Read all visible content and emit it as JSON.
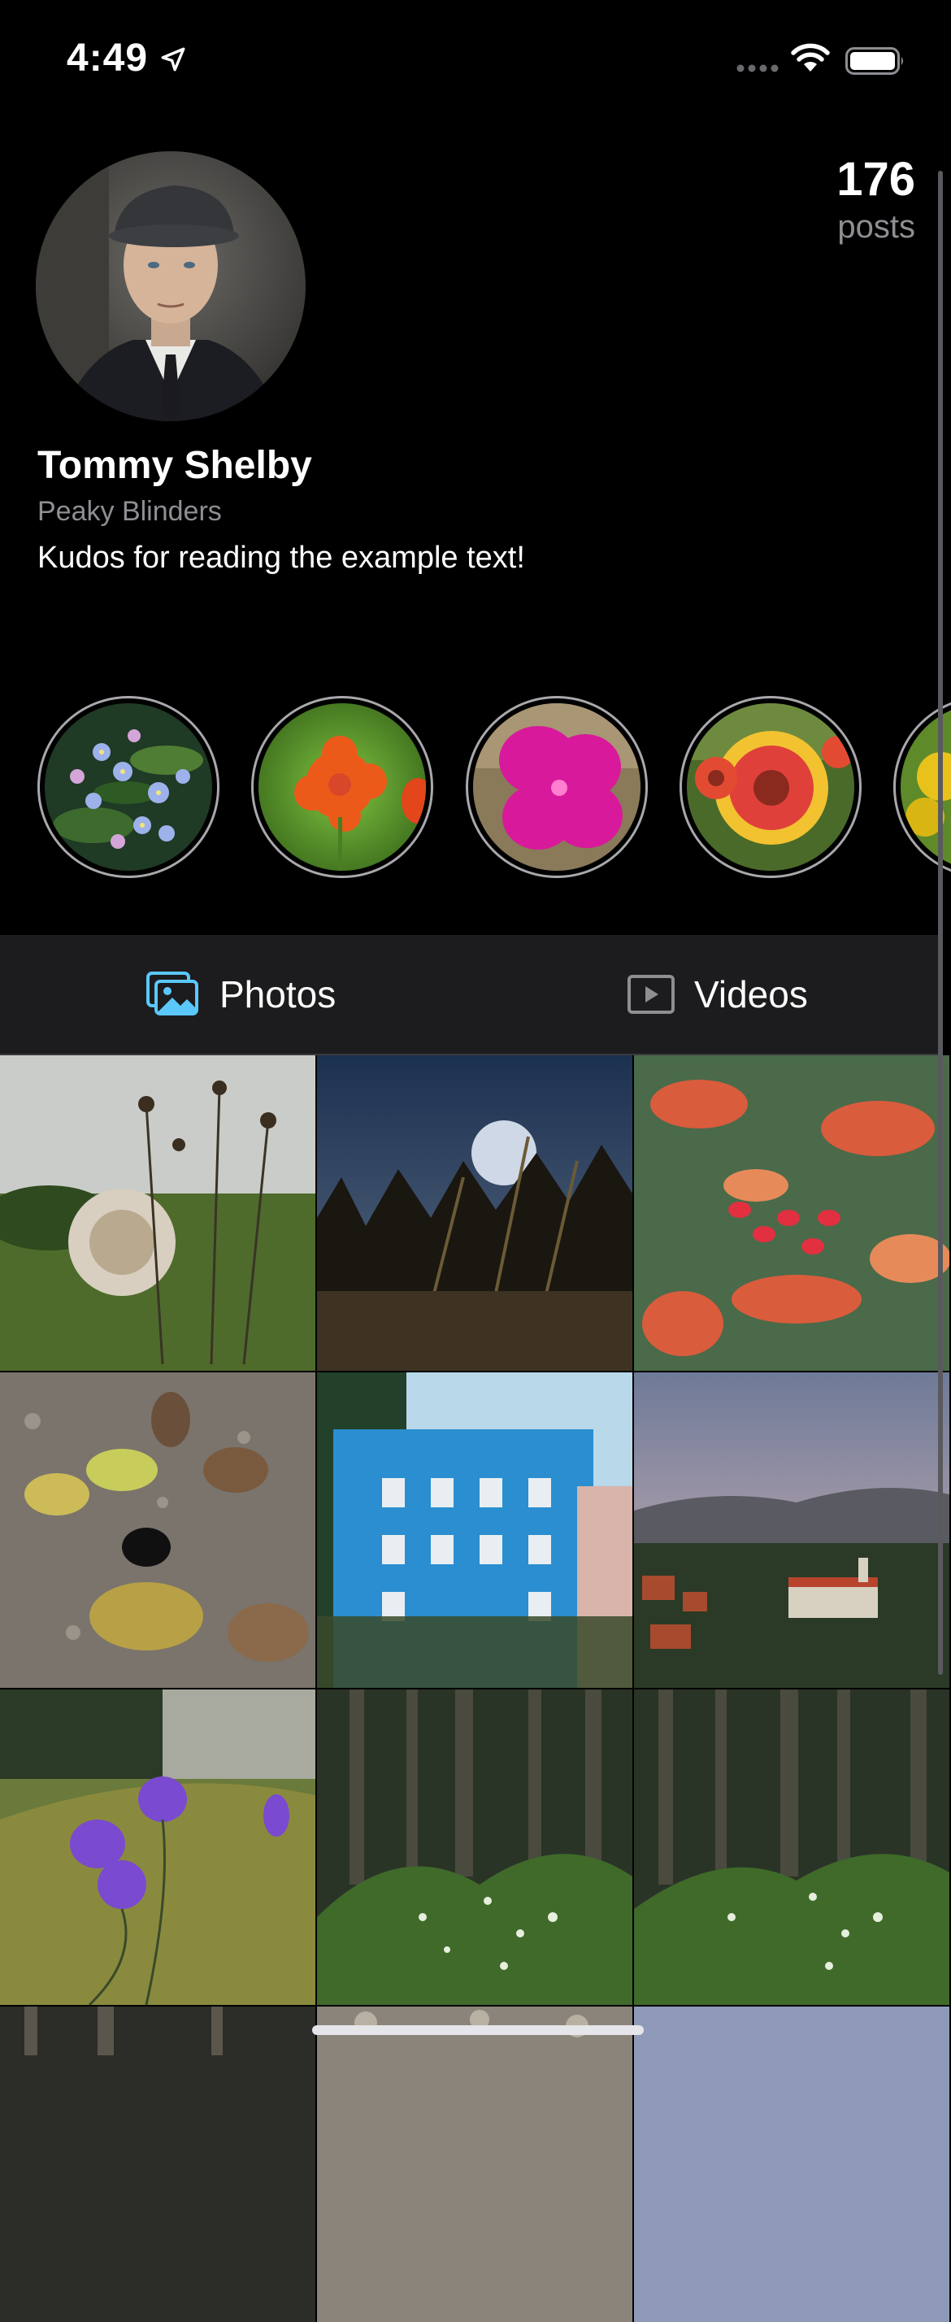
{
  "status_bar": {
    "time": "4:49"
  },
  "profile": {
    "name": "Tommy Shelby",
    "subtitle": "Peaky Blinders",
    "bio": "Kudos for reading the example text!",
    "posts_count": "176",
    "posts_label": "posts"
  },
  "highlights": [
    {
      "icon": "blue-forget-me-not-flowers"
    },
    {
      "icon": "orange-hawkweed-flower"
    },
    {
      "icon": "magenta-campion-flower"
    },
    {
      "icon": "red-gaillardia-flower"
    },
    {
      "icon": "yellow-flower"
    }
  ],
  "tabs": [
    {
      "label": "Photos",
      "icon": "photos-icon",
      "color": "#5ac8fa",
      "selected": true
    },
    {
      "label": "Videos",
      "icon": "video-play-icon",
      "color": "#8e8e93",
      "selected": false
    }
  ],
  "grid": [
    "dandelion-field",
    "tall-grass-silhouette",
    "red-berries-leaves",
    "acorns-beetle",
    "blue-building",
    "town-aerial-view",
    "harebell-flowers",
    "forest-dew",
    "forest-dew-2"
  ],
  "colors": {
    "accent": "#5ac8fa",
    "background": "#000000",
    "tab_bar": "#1c1c1e",
    "secondary_text": "#8e8e93"
  }
}
